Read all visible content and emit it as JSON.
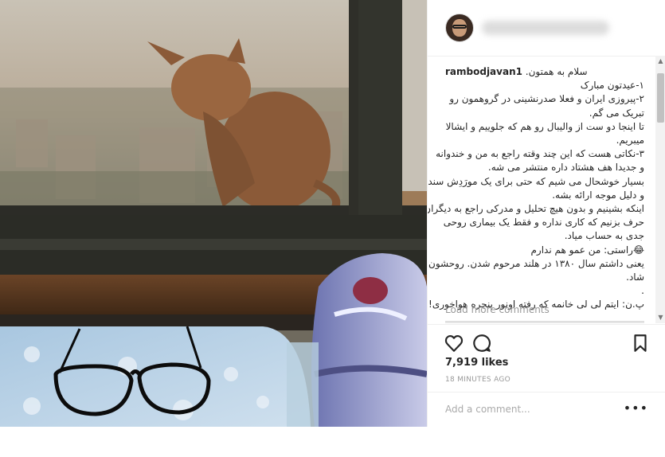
{
  "post": {
    "caption_user": "rambodjavan1",
    "caption_lines": [
      "سلام به همتون.",
      "۱-عیدتون مبارک",
      "۲-پیروزی ایران و فعلا صدرنشینی در گروهمون رو",
      "تبریک می گم.",
      "تا اینجا دو ست از والیبال رو هم که جلوییم و ایشالا",
      "میبریم.",
      "۳-نکاتی هست که این چند وقته راجع به من و خندوانه",
      "و جدیدا هف هشتاد داره منتشر می شه.",
      "بسیار خوشحال می شیم که حتی برای یک مورَدِش سند",
      "و دلیل موجه ارائه بشه.",
      "اینکه بشینیم و بدون هیچ تحلیل و مدرکی راجع به دیگران",
      "حرف بزنیم که کاری نداره و فقط یک بیماری روحی",
      "جدی به حساب میاد.",
      "😂راستی: من عمو هم ندارم",
      "یعنی داشتم سال ۱۳۸۰ در هلند مرحوم شدن. روحشون",
      "شاد.",
      ".",
      "پ.ن: ایتم لی لی خانمه که رفته اونور پنجره هواخوری!."
    ],
    "load_more": "Load more comments",
    "likes": "7,919 likes",
    "time": "18 MINUTES AGO",
    "add_comment_placeholder": "Add a comment...",
    "more_options": "•••"
  },
  "icons": {
    "heart": "heart-icon",
    "comment": "comment-icon",
    "bookmark": "bookmark-icon",
    "avatar": "profile-avatar"
  },
  "colors": {
    "text": "#262626",
    "muted": "#999999",
    "border": "#efefef"
  }
}
